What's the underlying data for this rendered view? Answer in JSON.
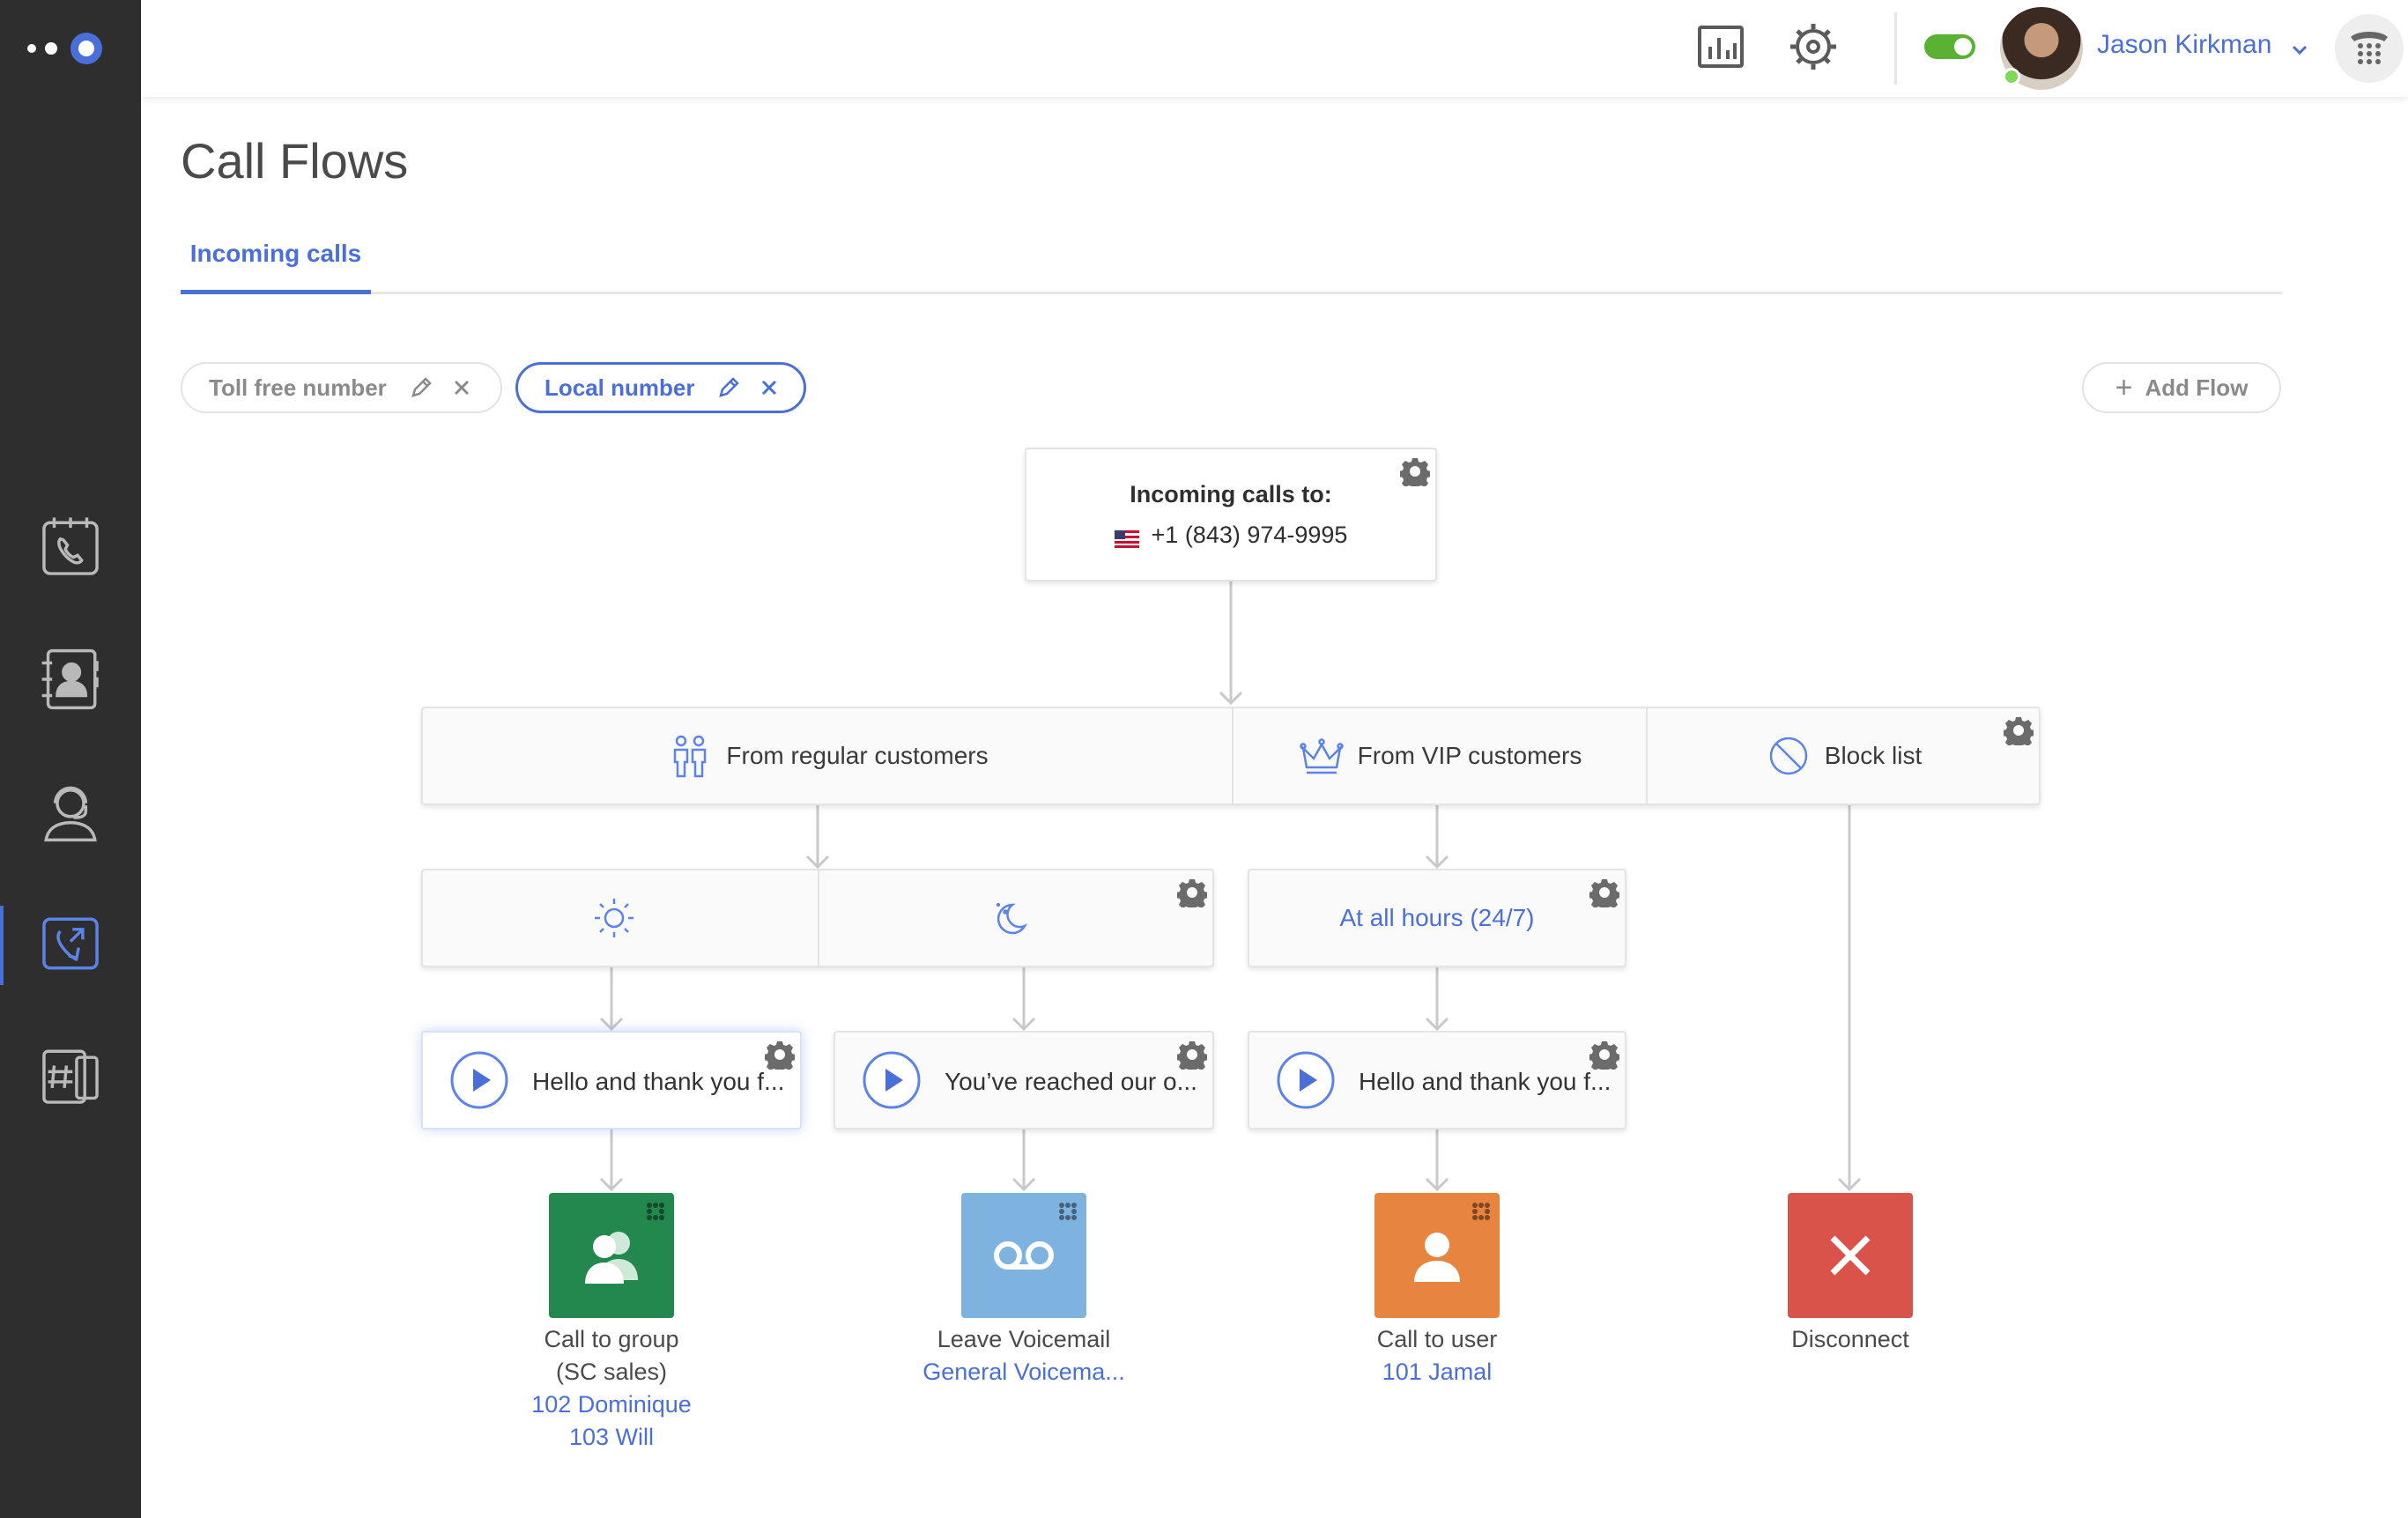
{
  "app": {
    "title": "Call Flows"
  },
  "user": {
    "name": "Jason Kirkman"
  },
  "tabs": [
    {
      "label": "Incoming calls"
    }
  ],
  "flow_chips": [
    {
      "label": "Toll free number"
    },
    {
      "label": "Local number"
    }
  ],
  "add_flow_label": "Add Flow",
  "incoming": {
    "title": "Incoming calls to:",
    "number": "+1 (843) 974-9995"
  },
  "segments": {
    "regular": "From regular customers",
    "vip": "From VIP customers",
    "block": "Block list"
  },
  "hours": {
    "all_hours": "At all hours (24/7)"
  },
  "messages": [
    {
      "text": "Hello and thank you f..."
    },
    {
      "text": "You’ve reached our o..."
    },
    {
      "text": "Hello and thank you f..."
    }
  ],
  "actions": {
    "group": {
      "label": "Call to group",
      "name": "(SC sales)",
      "members": [
        "102 Dominique",
        "103 Will"
      ],
      "color": "#22884e"
    },
    "voicemail": {
      "label": "Leave Voicemail",
      "target": "General Voicema...",
      "color": "#7fb3df"
    },
    "user": {
      "label": "Call to user",
      "target": "101 Jamal",
      "color": "#e7843f"
    },
    "disconnect": {
      "label": "Disconnect",
      "color": "#d9534a"
    }
  },
  "colors": {
    "accent": "#4a6fd8",
    "sidebar": "#2e2e2e",
    "toggle_on": "#5ab132"
  },
  "icons": {
    "sidebar": [
      "calendar-phone-icon",
      "contacts-icon",
      "agent-icon",
      "call-flow-icon",
      "numbers-icon"
    ],
    "topbar": [
      "analytics-icon",
      "settings-icon",
      "dialpad-icon"
    ]
  }
}
